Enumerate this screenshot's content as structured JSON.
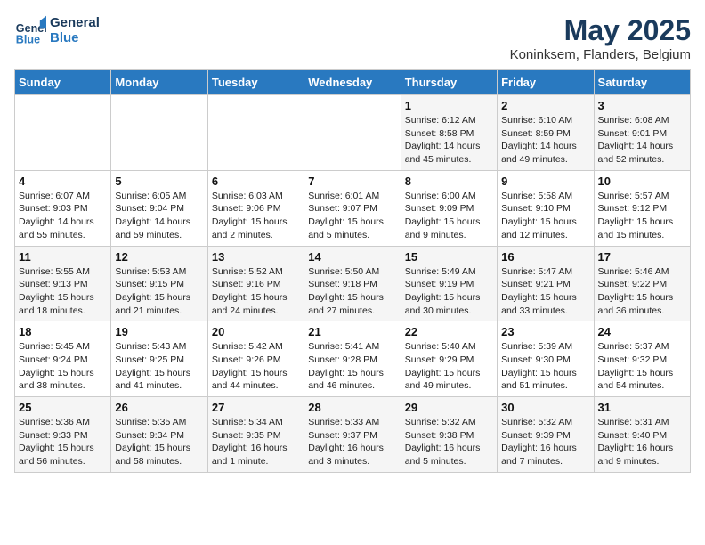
{
  "header": {
    "logo_line1": "General",
    "logo_line2": "Blue",
    "month_title": "May 2025",
    "location": "Koninksem, Flanders, Belgium"
  },
  "days_of_week": [
    "Sunday",
    "Monday",
    "Tuesday",
    "Wednesday",
    "Thursday",
    "Friday",
    "Saturday"
  ],
  "weeks": [
    [
      {
        "num": "",
        "info": ""
      },
      {
        "num": "",
        "info": ""
      },
      {
        "num": "",
        "info": ""
      },
      {
        "num": "",
        "info": ""
      },
      {
        "num": "1",
        "info": "Sunrise: 6:12 AM\nSunset: 8:58 PM\nDaylight: 14 hours\nand 45 minutes."
      },
      {
        "num": "2",
        "info": "Sunrise: 6:10 AM\nSunset: 8:59 PM\nDaylight: 14 hours\nand 49 minutes."
      },
      {
        "num": "3",
        "info": "Sunrise: 6:08 AM\nSunset: 9:01 PM\nDaylight: 14 hours\nand 52 minutes."
      }
    ],
    [
      {
        "num": "4",
        "info": "Sunrise: 6:07 AM\nSunset: 9:03 PM\nDaylight: 14 hours\nand 55 minutes."
      },
      {
        "num": "5",
        "info": "Sunrise: 6:05 AM\nSunset: 9:04 PM\nDaylight: 14 hours\nand 59 minutes."
      },
      {
        "num": "6",
        "info": "Sunrise: 6:03 AM\nSunset: 9:06 PM\nDaylight: 15 hours\nand 2 minutes."
      },
      {
        "num": "7",
        "info": "Sunrise: 6:01 AM\nSunset: 9:07 PM\nDaylight: 15 hours\nand 5 minutes."
      },
      {
        "num": "8",
        "info": "Sunrise: 6:00 AM\nSunset: 9:09 PM\nDaylight: 15 hours\nand 9 minutes."
      },
      {
        "num": "9",
        "info": "Sunrise: 5:58 AM\nSunset: 9:10 PM\nDaylight: 15 hours\nand 12 minutes."
      },
      {
        "num": "10",
        "info": "Sunrise: 5:57 AM\nSunset: 9:12 PM\nDaylight: 15 hours\nand 15 minutes."
      }
    ],
    [
      {
        "num": "11",
        "info": "Sunrise: 5:55 AM\nSunset: 9:13 PM\nDaylight: 15 hours\nand 18 minutes."
      },
      {
        "num": "12",
        "info": "Sunrise: 5:53 AM\nSunset: 9:15 PM\nDaylight: 15 hours\nand 21 minutes."
      },
      {
        "num": "13",
        "info": "Sunrise: 5:52 AM\nSunset: 9:16 PM\nDaylight: 15 hours\nand 24 minutes."
      },
      {
        "num": "14",
        "info": "Sunrise: 5:50 AM\nSunset: 9:18 PM\nDaylight: 15 hours\nand 27 minutes."
      },
      {
        "num": "15",
        "info": "Sunrise: 5:49 AM\nSunset: 9:19 PM\nDaylight: 15 hours\nand 30 minutes."
      },
      {
        "num": "16",
        "info": "Sunrise: 5:47 AM\nSunset: 9:21 PM\nDaylight: 15 hours\nand 33 minutes."
      },
      {
        "num": "17",
        "info": "Sunrise: 5:46 AM\nSunset: 9:22 PM\nDaylight: 15 hours\nand 36 minutes."
      }
    ],
    [
      {
        "num": "18",
        "info": "Sunrise: 5:45 AM\nSunset: 9:24 PM\nDaylight: 15 hours\nand 38 minutes."
      },
      {
        "num": "19",
        "info": "Sunrise: 5:43 AM\nSunset: 9:25 PM\nDaylight: 15 hours\nand 41 minutes."
      },
      {
        "num": "20",
        "info": "Sunrise: 5:42 AM\nSunset: 9:26 PM\nDaylight: 15 hours\nand 44 minutes."
      },
      {
        "num": "21",
        "info": "Sunrise: 5:41 AM\nSunset: 9:28 PM\nDaylight: 15 hours\nand 46 minutes."
      },
      {
        "num": "22",
        "info": "Sunrise: 5:40 AM\nSunset: 9:29 PM\nDaylight: 15 hours\nand 49 minutes."
      },
      {
        "num": "23",
        "info": "Sunrise: 5:39 AM\nSunset: 9:30 PM\nDaylight: 15 hours\nand 51 minutes."
      },
      {
        "num": "24",
        "info": "Sunrise: 5:37 AM\nSunset: 9:32 PM\nDaylight: 15 hours\nand 54 minutes."
      }
    ],
    [
      {
        "num": "25",
        "info": "Sunrise: 5:36 AM\nSunset: 9:33 PM\nDaylight: 15 hours\nand 56 minutes."
      },
      {
        "num": "26",
        "info": "Sunrise: 5:35 AM\nSunset: 9:34 PM\nDaylight: 15 hours\nand 58 minutes."
      },
      {
        "num": "27",
        "info": "Sunrise: 5:34 AM\nSunset: 9:35 PM\nDaylight: 16 hours\nand 1 minute."
      },
      {
        "num": "28",
        "info": "Sunrise: 5:33 AM\nSunset: 9:37 PM\nDaylight: 16 hours\nand 3 minutes."
      },
      {
        "num": "29",
        "info": "Sunrise: 5:32 AM\nSunset: 9:38 PM\nDaylight: 16 hours\nand 5 minutes."
      },
      {
        "num": "30",
        "info": "Sunrise: 5:32 AM\nSunset: 9:39 PM\nDaylight: 16 hours\nand 7 minutes."
      },
      {
        "num": "31",
        "info": "Sunrise: 5:31 AM\nSunset: 9:40 PM\nDaylight: 16 hours\nand 9 minutes."
      }
    ]
  ]
}
